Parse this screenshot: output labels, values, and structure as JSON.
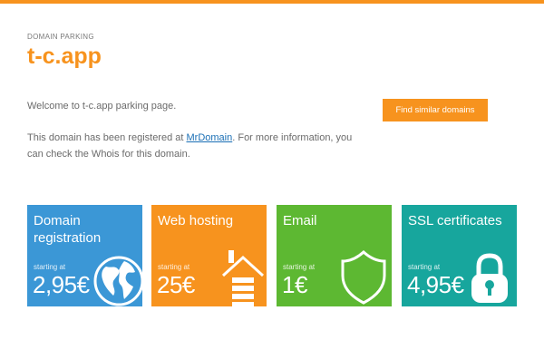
{
  "header": {
    "eyebrow": "DOMAIN PARKING",
    "domain": "t-c.app"
  },
  "intro": {
    "welcome": "Welcome to t-c.app parking page.",
    "registered_prefix": "This domain has been registered at ",
    "registrar_link": "MrDomain",
    "registered_suffix": ". For more information, you can check the Whois for this domain."
  },
  "actions": {
    "find_similar": "Find similar domains"
  },
  "tiles": [
    {
      "name": "Domain registration",
      "starting": "starting at",
      "price": "2,95€",
      "icon": "globe-icon"
    },
    {
      "name": "Web hosting",
      "starting": "starting at",
      "price": "25€",
      "icon": "server-house-icon"
    },
    {
      "name": "Email",
      "starting": "starting at",
      "price": "1€",
      "icon": "shield-icon"
    },
    {
      "name": "SSL certificates",
      "starting": "starting at",
      "price": "4,95€",
      "icon": "padlock-icon"
    }
  ],
  "colors": {
    "accent": "#f7931e",
    "link": "#1a6fb5",
    "tile_domain": "#3b97d6",
    "tile_hosting": "#f7931e",
    "tile_email": "#5db832",
    "tile_ssl": "#17a69d"
  }
}
